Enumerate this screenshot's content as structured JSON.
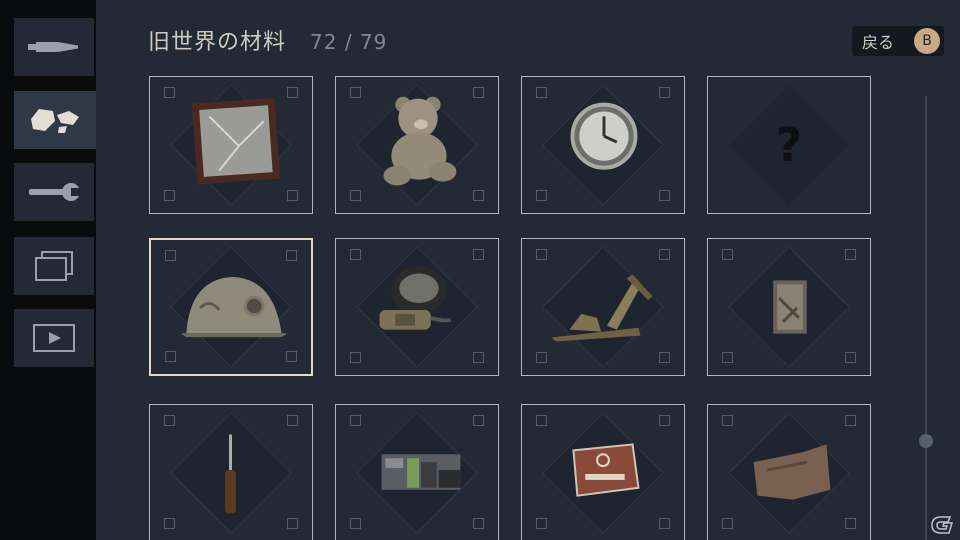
{
  "header": {
    "title": "旧世界の材料",
    "collected": "72 / 79",
    "back_label": "戻る",
    "back_key": "B"
  },
  "tabs": [
    {
      "name": "tab-ammo",
      "icon": "bullet-icon",
      "active": false
    },
    {
      "name": "tab-materials",
      "icon": "rocks-icon",
      "active": true
    },
    {
      "name": "tab-tools",
      "icon": "wrench-icon",
      "active": false
    },
    {
      "name": "tab-gallery",
      "icon": "gallery-icon",
      "active": false
    },
    {
      "name": "tab-videos",
      "icon": "play-icon",
      "active": false
    }
  ],
  "items": [
    {
      "name": "item-broken-frame",
      "icon": "broken-frame-icon",
      "known": true
    },
    {
      "name": "item-teddy-bear",
      "icon": "teddy-bear-icon",
      "known": true
    },
    {
      "name": "item-clock",
      "icon": "clock-icon",
      "known": true
    },
    {
      "name": "item-unknown",
      "icon": "question-mark-icon",
      "known": false,
      "label": "?"
    },
    {
      "name": "item-helmet",
      "icon": "helmet-icon",
      "known": true,
      "selected": true
    },
    {
      "name": "item-gas-mask",
      "icon": "gas-mask-icon",
      "known": true
    },
    {
      "name": "item-wood-plane",
      "icon": "wood-plane-icon",
      "known": true
    },
    {
      "name": "item-photo-scrap",
      "icon": "photo-scrap-icon",
      "known": true
    },
    {
      "name": "item-screwdriver",
      "icon": "screwdriver-icon",
      "known": true
    },
    {
      "name": "item-battery-pack",
      "icon": "battery-icon",
      "known": true
    },
    {
      "name": "item-biohazard-case",
      "icon": "biohazard-case-icon",
      "known": true
    },
    {
      "name": "item-torn-paper",
      "icon": "torn-paper-icon",
      "known": true
    }
  ],
  "scrollbar": {
    "position": 0.78
  },
  "colors": {
    "panel": "#232a36",
    "accent": "#c9a885",
    "selected_border": "#e6d8c8"
  }
}
